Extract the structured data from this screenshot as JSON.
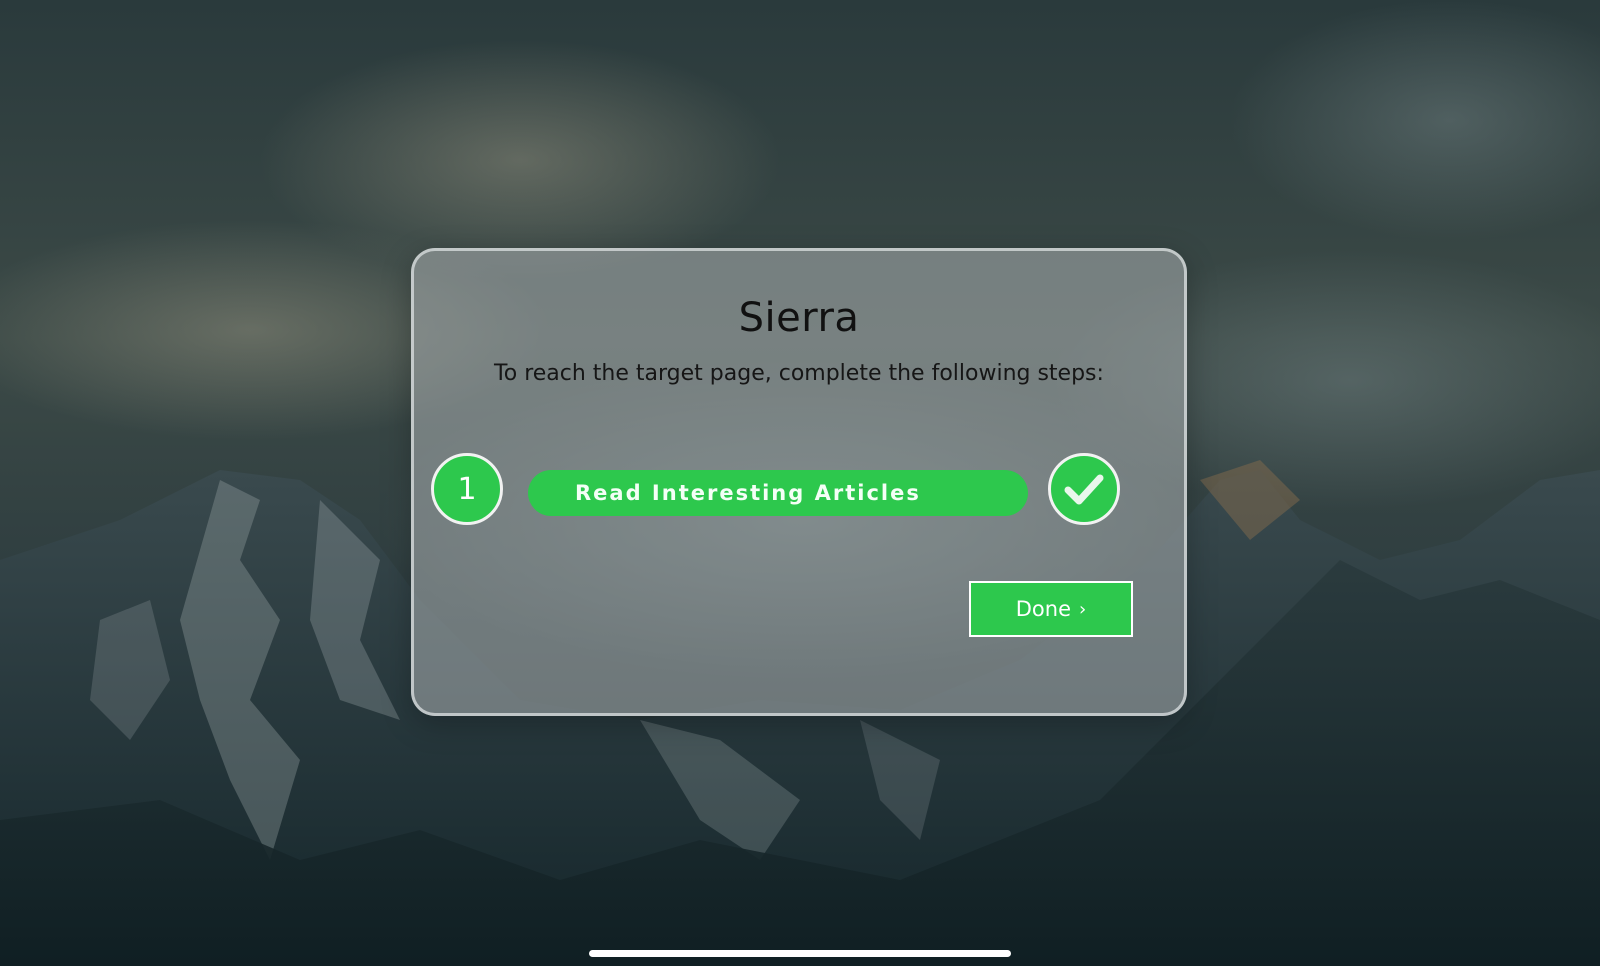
{
  "modal": {
    "title": "Sierra",
    "subtitle": "To reach the target page, complete the following steps:",
    "steps": [
      {
        "number": "1",
        "label": "Read Interesting Articles",
        "status_icon": "checkmark-icon",
        "completed": true
      }
    ],
    "done_label": "Done",
    "done_icon": "chevron-right-icon"
  },
  "background": {
    "description_icon": "mountain-landscape-image"
  },
  "colors": {
    "accent": "#2dc84d",
    "modal_border": "#dce0e2",
    "text": "#111111"
  }
}
